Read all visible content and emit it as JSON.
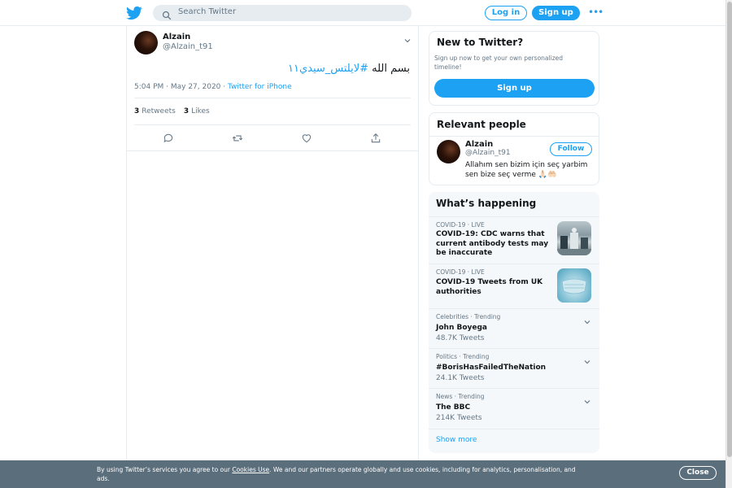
{
  "header": {
    "search_placeholder": "Search Twitter",
    "login_label": "Log in",
    "signup_label": "Sign up",
    "more_icon": "more-dots-icon",
    "logo_icon": "twitter-bird-icon"
  },
  "tweet": {
    "author_name": "Alzain",
    "author_handle": "@Alzain_t91",
    "text_plain": "بسم الله ",
    "text_hashtag": "#لايلتس_سيدي١١",
    "time": "5:04 PM · May 27, 2020 · ",
    "source": "Twitter for iPhone",
    "retweets_count": "3",
    "retweets_label": "Retweets",
    "likes_count": "3",
    "likes_label": "Likes"
  },
  "new_to_twitter": {
    "title": "New to Twitter?",
    "description": "Sign up now to get your own personalized timeline!",
    "signup_label": "Sign up"
  },
  "relevant_people": {
    "title": "Relevant people",
    "person": {
      "name": "Alzain",
      "handle": "@Alzain_t91",
      "follow_label": "Follow",
      "bio": "Allahım sen bizim için seç yarbim sen bize seç verme 🙏🏻🤲🏻"
    }
  },
  "whats_happening": {
    "title": "What’s happening",
    "trends": [
      {
        "context": "COVID-19 · LIVE",
        "title": "COVID-19: CDC warns that current antibody tests may be inaccurate",
        "count": ""
      },
      {
        "context": "COVID-19 · LIVE",
        "title": "COVID-19 Tweets from UK authorities",
        "count": ""
      },
      {
        "context": "Celebrities · Trending",
        "title": "John Boyega",
        "count": "48.7K Tweets"
      },
      {
        "context": "Politics · Trending",
        "title": "#BorisHasFailedTheNation",
        "count": "24.1K Tweets"
      },
      {
        "context": "News · Trending",
        "title": "The BBC",
        "count": "214K Tweets"
      }
    ],
    "show_more": "Show more"
  },
  "cookie_banner": {
    "text_before": "By using Twitter’s services you agree to our ",
    "link": "Cookies Use",
    "text_after": ". We and our partners operate globally and use cookies, including for analytics, personalisation, and ads.",
    "close_label": "Close"
  },
  "colors": {
    "accent": "#1da1f2",
    "banner": "#5b6e7c",
    "muted": "#657786"
  }
}
